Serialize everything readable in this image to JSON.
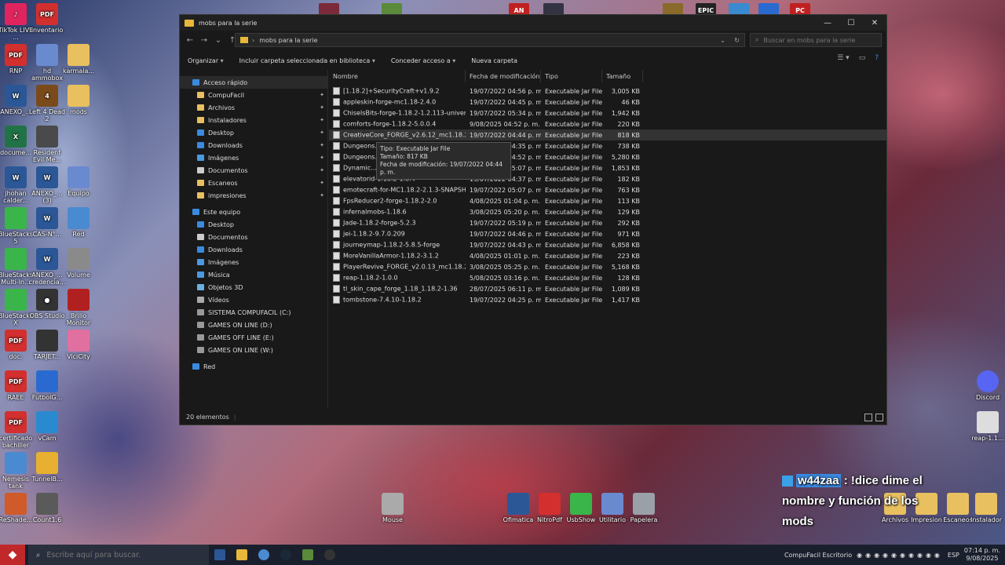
{
  "desktop_left": [
    {
      "label": "TikTok LIVE ...",
      "color": "#e0245e",
      "glyph": "♪"
    },
    {
      "label": "inventario",
      "color": "#d32f2f",
      "glyph": "PDF"
    },
    {
      "label": "RNP",
      "color": "#d32f2f",
      "glyph": "PDF"
    },
    {
      "label": "hd ammobox",
      "color": "#6a8ad0",
      "glyph": ""
    },
    {
      "label": "karmala...",
      "color": "#e8c060",
      "glyph": ""
    },
    {
      "label": "ANEXO_...",
      "color": "#2b5797",
      "glyph": "W"
    },
    {
      "label": "Left 4 Dead 2",
      "color": "#7a4a1a",
      "glyph": "4"
    },
    {
      "label": "mods",
      "color": "#e8c060",
      "glyph": ""
    },
    {
      "label": "docume...",
      "color": "#217346",
      "glyph": "X"
    },
    {
      "label": "Resident Evil Me...",
      "color": "#4a4a4a",
      "glyph": ""
    },
    {
      "label": "jhohan calder...",
      "color": "#2b5797",
      "glyph": "W"
    },
    {
      "label": "ANEXO_... (3)",
      "color": "#2b5797",
      "glyph": "W"
    },
    {
      "label": "Equipo",
      "color": "#6a8ad0",
      "glyph": ""
    },
    {
      "label": "BlueStacks 5",
      "color": "#3ab54a",
      "glyph": ""
    },
    {
      "label": "CAS-N°...",
      "color": "#2b5797",
      "glyph": "W"
    },
    {
      "label": "Red",
      "color": "#4a8ad0",
      "glyph": ""
    },
    {
      "label": "BlueStacks Multi-In...",
      "color": "#3ab54a",
      "glyph": ""
    },
    {
      "label": "ANEXO_... credencia...",
      "color": "#2b5797",
      "glyph": "W"
    },
    {
      "label": "Volume",
      "color": "#8a8a8a",
      "glyph": ""
    },
    {
      "label": "BlueStacks X",
      "color": "#3ab54a",
      "glyph": ""
    },
    {
      "label": "OBS Studio",
      "color": "#333333",
      "glyph": "●"
    },
    {
      "label": "Brillo Monitor",
      "color": "#b02020",
      "glyph": ""
    },
    {
      "label": "doc.",
      "color": "#d32f2f",
      "glyph": "PDF"
    },
    {
      "label": "TARJET...",
      "color": "#333333",
      "glyph": ""
    },
    {
      "label": "ViciCity",
      "color": "#e070a0",
      "glyph": ""
    },
    {
      "label": "RAEE",
      "color": "#d32f2f",
      "glyph": "PDF"
    },
    {
      "label": "FutbolG...",
      "color": "#2a6ad0",
      "glyph": ""
    },
    {
      "label": "certificado bachiller",
      "color": "#d32f2f",
      "glyph": "PDF"
    },
    {
      "label": "vCam",
      "color": "#2a8ad0",
      "glyph": ""
    },
    {
      "label": "Nemesis tank",
      "color": "#4a8ad0",
      "glyph": ""
    },
    {
      "label": "TunnelB...",
      "color": "#e8b030",
      "glyph": ""
    },
    {
      "label": "ReShade...",
      "color": "#d05a2a",
      "glyph": ""
    },
    {
      "label": "Count1.6",
      "color": "#5a5a5a",
      "glyph": ""
    }
  ],
  "desktop_bottom": [
    {
      "label": "Mouse",
      "color": "#aaaaaa"
    },
    {
      "label": "Ofimatica",
      "color": "#2b5797"
    },
    {
      "label": "NitroPdf",
      "color": "#d32f2f"
    },
    {
      "label": "UsbShow",
      "color": "#3ab54a"
    },
    {
      "label": "Utilitario",
      "color": "#6a8ad0"
    },
    {
      "label": "Papelera",
      "color": "#9aa0a8"
    }
  ],
  "desktop_right": [
    {
      "label": "Discord",
      "color": "#5865f2"
    },
    {
      "label": "reap-1.1...",
      "color": "#dddddd"
    },
    {
      "label": "Archivos",
      "color": "#e8c060"
    },
    {
      "label": "Impresion",
      "color": "#e8c060"
    },
    {
      "label": "Escaneos",
      "color": "#e8c060"
    },
    {
      "label": "Instalador",
      "color": "#e8c060"
    }
  ],
  "top_strip": [
    "",
    "",
    "AN",
    "",
    "",
    "EPIC",
    "",
    "",
    "PC"
  ],
  "window": {
    "title": "mobs para la serie",
    "minimize": "—",
    "maximize": "☐",
    "close": "✕"
  },
  "address": {
    "path": "mobs para la serie"
  },
  "search": {
    "placeholder": "Buscar en mobs para la serie"
  },
  "toolbar": {
    "organize": "Organizar",
    "include": "Incluir carpeta seleccionada en biblioteca",
    "share": "Conceder acceso a",
    "new_folder": "Nueva carpeta"
  },
  "nav": {
    "quick_access": "Acceso rápido",
    "quick_items": [
      "CompuFacil",
      "Archivos",
      "Instaladores",
      "Desktop",
      "Downloads",
      "Imágenes",
      "Documentos",
      "Escaneos",
      "impresiones"
    ],
    "this_pc": "Este equipo",
    "pc_items": [
      "Desktop",
      "Documentos",
      "Downloads",
      "Imágenes",
      "Música",
      "Objetos 3D",
      "Vídeos",
      "SISTEMA COMPUFACIL (C:)",
      "GAMES ON LINE (D:)",
      "GAMES OFF LINE (E:)",
      "GAMES ON LINE (W:)"
    ],
    "network": "Red"
  },
  "columns": {
    "name": "Nombre",
    "date": "Fecha de modificación",
    "type": "Tipo",
    "size": "Tamaño"
  },
  "files": [
    {
      "name": "[1.18.2]+SecurityCraft+v1.9.2",
      "date": "19/07/2022 04:56 p. m.",
      "type": "Executable Jar File",
      "size": "3,005 KB"
    },
    {
      "name": "appleskin-forge-mc1.18-2.4.0",
      "date": "19/07/2022 04:45 p. m.",
      "type": "Executable Jar File",
      "size": "46 KB"
    },
    {
      "name": "ChiselsBits-forge-1.18.2-1.2.113-universal",
      "date": "19/07/2022 05:34 p. m.",
      "type": "Executable Jar File",
      "size": "1,942 KB"
    },
    {
      "name": "comforts-forge-1.18.2-5.0.0.4",
      "date": "9/08/2025 04:52 p. m.",
      "type": "Executable Jar File",
      "size": "220 KB"
    },
    {
      "name": "CreativeCore_FORGE_v2.6.12_mc1.18.2",
      "date": "19/07/2022 04:44 p. m.",
      "type": "Executable Jar File",
      "size": "818 KB"
    },
    {
      "name": "Dungeons...",
      "date": "19/07/2022 04:35 p. m.",
      "type": "Executable Jar File",
      "size": "738 KB"
    },
    {
      "name": "Dungeons...",
      "date": "19/07/2022 04:52 p. m.",
      "type": "Executable Jar File",
      "size": "5,280 KB"
    },
    {
      "name": "Dynamic...",
      "date": "19/07/2022 05:07 p. m.",
      "type": "Executable Jar File",
      "size": "1,853 KB"
    },
    {
      "name": "elevatorid-1.18.2-1.8.4",
      "date": "19/07/2022 04:37 p. m.",
      "type": "Executable Jar File",
      "size": "182 KB"
    },
    {
      "name": "emotecraft-for-MC1.18.2-2.1.3-SNAPSH...",
      "date": "19/07/2022 05:07 p. m.",
      "type": "Executable Jar File",
      "size": "763 KB"
    },
    {
      "name": "FpsReducer2-forge-1.18.2-2.0",
      "date": "4/08/2025 01:04 p. m.",
      "type": "Executable Jar File",
      "size": "113 KB"
    },
    {
      "name": "infernalmobs-1.18.6",
      "date": "3/08/2025 05:20 p. m.",
      "type": "Executable Jar File",
      "size": "129 KB"
    },
    {
      "name": "Jade-1.18.2-forge-5.2.3",
      "date": "19/07/2022 05:19 p. m.",
      "type": "Executable Jar File",
      "size": "292 KB"
    },
    {
      "name": "jei-1.18.2-9.7.0.209",
      "date": "19/07/2022 04:46 p. m.",
      "type": "Executable Jar File",
      "size": "971 KB"
    },
    {
      "name": "journeymap-1.18.2-5.8.5-forge",
      "date": "19/07/2022 04:43 p. m.",
      "type": "Executable Jar File",
      "size": "6,858 KB"
    },
    {
      "name": "MoreVanillaArmor-1.18.2-3.1.2",
      "date": "4/08/2025 01:01 p. m.",
      "type": "Executable Jar File",
      "size": "223 KB"
    },
    {
      "name": "PlayerRevive_FORGE_v2.0.13_mc1.18.2",
      "date": "3/08/2025 05:25 p. m.",
      "type": "Executable Jar File",
      "size": "5,168 KB"
    },
    {
      "name": "reap-1.18.2-1.0.0",
      "date": "5/08/2025 03:16 p. m.",
      "type": "Executable Jar File",
      "size": "128 KB"
    },
    {
      "name": "tl_skin_cape_forge_1.18_1.18.2-1.36",
      "date": "28/07/2025 06:11 p. m.",
      "type": "Executable Jar File",
      "size": "1,089 KB"
    },
    {
      "name": "tombstone-7.4.10-1.18.2",
      "date": "19/07/2022 04:25 p. m.",
      "type": "Executable Jar File",
      "size": "1,417 KB"
    }
  ],
  "tooltip": {
    "type": "Tipo: Executable Jar File",
    "size": "Tamaño: 817 KB",
    "date": "Fecha de modificación: 19/07/2022 04:44 p. m."
  },
  "status": {
    "count": "20 elementos"
  },
  "taskbar": {
    "search_placeholder": "Escribe aquí para buscar.",
    "tray_label": "CompuFacil Escritorio",
    "lang": "ESP",
    "time": "07:14 p. m.",
    "date": "9/08/2025"
  },
  "chat": {
    "user": "w44zaa",
    "message": ": !dice dime el nombre y función de los mods"
  }
}
